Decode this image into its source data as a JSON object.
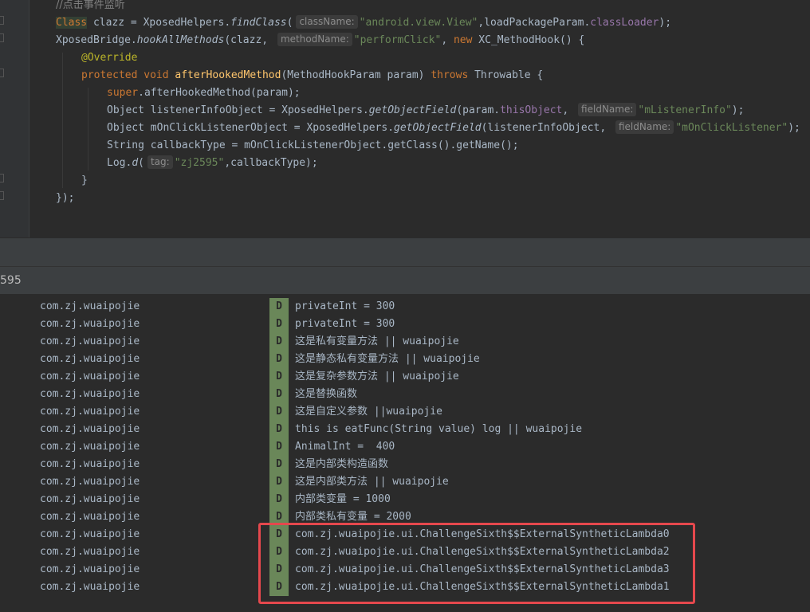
{
  "editor": {
    "lines": [
      {
        "parts": [
          {
            "t": "//点击事件监听",
            "c": "cmt"
          }
        ]
      },
      {
        "parts": [
          {
            "t": "Class",
            "c": "kw cls-hl"
          },
          {
            "t": " clazz = XposedHelpers."
          },
          {
            "t": "findClass",
            "c": "ital"
          },
          {
            "t": "("
          },
          {
            "hint": "className:"
          },
          {
            "t": "\"android.view.View\"",
            "c": "str"
          },
          {
            "t": ",loadPackageParam."
          },
          {
            "t": "classLoader",
            "c": "fld"
          },
          {
            "t": ");"
          }
        ]
      },
      {
        "parts": [
          {
            "t": "XposedBridge."
          },
          {
            "t": "hookAllMethods",
            "c": "ital"
          },
          {
            "t": "(clazz, "
          },
          {
            "hint": "methodName:"
          },
          {
            "t": "\"performClick\"",
            "c": "str"
          },
          {
            "t": ", "
          },
          {
            "t": "new",
            "c": "kw"
          },
          {
            "t": " XC_MethodHook() {"
          }
        ]
      },
      {
        "parts": [
          {
            "t": "@Override",
            "c": "ann"
          }
        ]
      },
      {
        "parts": [
          {
            "t": "protected void ",
            "c": "kw"
          },
          {
            "t": "afterHookedMethod",
            "c": "fn"
          },
          {
            "t": "(MethodHookParam param) "
          },
          {
            "t": "throws",
            "c": "kw"
          },
          {
            "t": " Throwable {"
          }
        ]
      },
      {
        "parts": [
          {
            "t": "super",
            "c": "kw"
          },
          {
            "t": ".afterHookedMethod(param);"
          }
        ]
      },
      {
        "parts": [
          {
            "t": "Object listenerInfoObject = XposedHelpers."
          },
          {
            "t": "getObjectField",
            "c": "ital"
          },
          {
            "t": "(param."
          },
          {
            "t": "thisObject",
            "c": "fld"
          },
          {
            "t": ", "
          },
          {
            "hint": "fieldName:"
          },
          {
            "t": "\"mListenerInfo\"",
            "c": "str"
          },
          {
            "t": ");"
          }
        ]
      },
      {
        "parts": [
          {
            "t": "Object mOnClickListenerObject = XposedHelpers."
          },
          {
            "t": "getObjectField",
            "c": "ital"
          },
          {
            "t": "(listenerInfoObject, "
          },
          {
            "hint": "fieldName:"
          },
          {
            "t": "\"mOnClickListener\"",
            "c": "str"
          },
          {
            "t": ");"
          }
        ]
      },
      {
        "parts": [
          {
            "t": "String callbackType = mOnClickListenerObject.getClass().getName();"
          }
        ]
      },
      {
        "parts": [
          {
            "t": "Log."
          },
          {
            "t": "d",
            "c": "ital"
          },
          {
            "t": "("
          },
          {
            "hint": "tag:"
          },
          {
            "t": "\"zj2595\"",
            "c": "str"
          },
          {
            "t": ",callbackType);"
          }
        ]
      },
      {
        "parts": [
          {
            "t": "}"
          }
        ]
      },
      {
        "parts": [
          {
            "t": "});"
          }
        ]
      }
    ]
  },
  "filter": {
    "text": "595"
  },
  "logcat": {
    "level_color": "#6a8759",
    "highlight_color": "#e5484d",
    "rows": [
      {
        "pkg": "com.zj.wuaipojie",
        "level": "D",
        "msg": "privateInt = 300"
      },
      {
        "pkg": "com.zj.wuaipojie",
        "level": "D",
        "msg": "privateInt = 300"
      },
      {
        "pkg": "com.zj.wuaipojie",
        "level": "D",
        "msg": "这是私有变量方法 || wuaipojie"
      },
      {
        "pkg": "com.zj.wuaipojie",
        "level": "D",
        "msg": "这是静态私有变量方法 || wuaipojie"
      },
      {
        "pkg": "com.zj.wuaipojie",
        "level": "D",
        "msg": "这是复杂参数方法 || wuaipojie"
      },
      {
        "pkg": "com.zj.wuaipojie",
        "level": "D",
        "msg": "这是替换函数"
      },
      {
        "pkg": "com.zj.wuaipojie",
        "level": "D",
        "msg": "这是自定义参数 ||wuaipojie"
      },
      {
        "pkg": "com.zj.wuaipojie",
        "level": "D",
        "msg": "this is eatFunc(String value) log || wuaipojie"
      },
      {
        "pkg": "com.zj.wuaipojie",
        "level": "D",
        "msg": "AnimalInt =  400"
      },
      {
        "pkg": "com.zj.wuaipojie",
        "level": "D",
        "msg": "这是内部类构造函数"
      },
      {
        "pkg": "com.zj.wuaipojie",
        "level": "D",
        "msg": "这是内部类方法 || wuaipojie"
      },
      {
        "pkg": "com.zj.wuaipojie",
        "level": "D",
        "msg": "内部类变量 = 1000"
      },
      {
        "pkg": "com.zj.wuaipojie",
        "level": "D",
        "msg": "内部类私有变量 = 2000"
      },
      {
        "pkg": "com.zj.wuaipojie",
        "level": "D",
        "msg": "com.zj.wuaipojie.ui.ChallengeSixth$$ExternalSyntheticLambda0"
      },
      {
        "pkg": "com.zj.wuaipojie",
        "level": "D",
        "msg": "com.zj.wuaipojie.ui.ChallengeSixth$$ExternalSyntheticLambda2"
      },
      {
        "pkg": "com.zj.wuaipojie",
        "level": "D",
        "msg": "com.zj.wuaipojie.ui.ChallengeSixth$$ExternalSyntheticLambda3"
      },
      {
        "pkg": "com.zj.wuaipojie",
        "level": "D",
        "msg": "com.zj.wuaipojie.ui.ChallengeSixth$$ExternalSyntheticLambda1"
      }
    ]
  }
}
